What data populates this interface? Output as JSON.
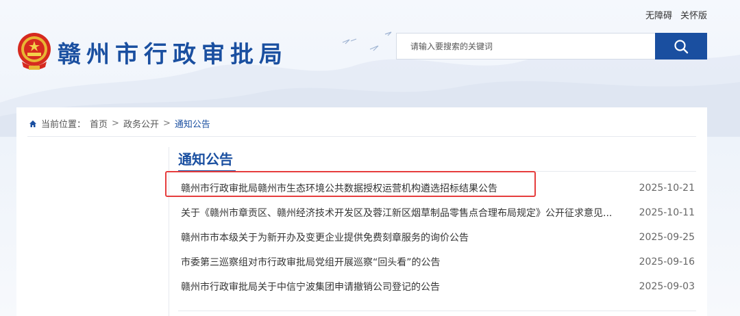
{
  "top_links": [
    "无障碍",
    "关怀版"
  ],
  "site": {
    "title": "赣州市行政审批局"
  },
  "search": {
    "placeholder": "请输入要搜索的关键词",
    "icon": "search-icon"
  },
  "breadcrumb": {
    "label": "当前位置：",
    "separator": ">",
    "items": [
      "首页",
      "政务公开",
      "通知公告"
    ]
  },
  "section": {
    "title": "通知公告"
  },
  "list": [
    {
      "title": "赣州市行政审批局赣州市生态环境公共数据授权运营机构遴选招标结果公告",
      "date": "2025-10-21"
    },
    {
      "title": "关于《赣州市章贡区、赣州经济技术开发区及蓉江新区烟草制品零售点合理布局规定》公开征求意见...",
      "date": "2025-10-11"
    },
    {
      "title": "赣州市市本级关于为新开办及变更企业提供免费刻章服务的询价公告",
      "date": "2025-09-25"
    },
    {
      "title": "市委第三巡察组对市行政审批局党组开展巡察“回头看”的公告",
      "date": "2025-09-16"
    },
    {
      "title": "赣州市行政审批局关于中信宁波集团申请撤销公司登记的公告",
      "date": "2025-09-03"
    }
  ],
  "colors": {
    "brand": "#1a4fa0",
    "highlight": "#e63c3c"
  }
}
